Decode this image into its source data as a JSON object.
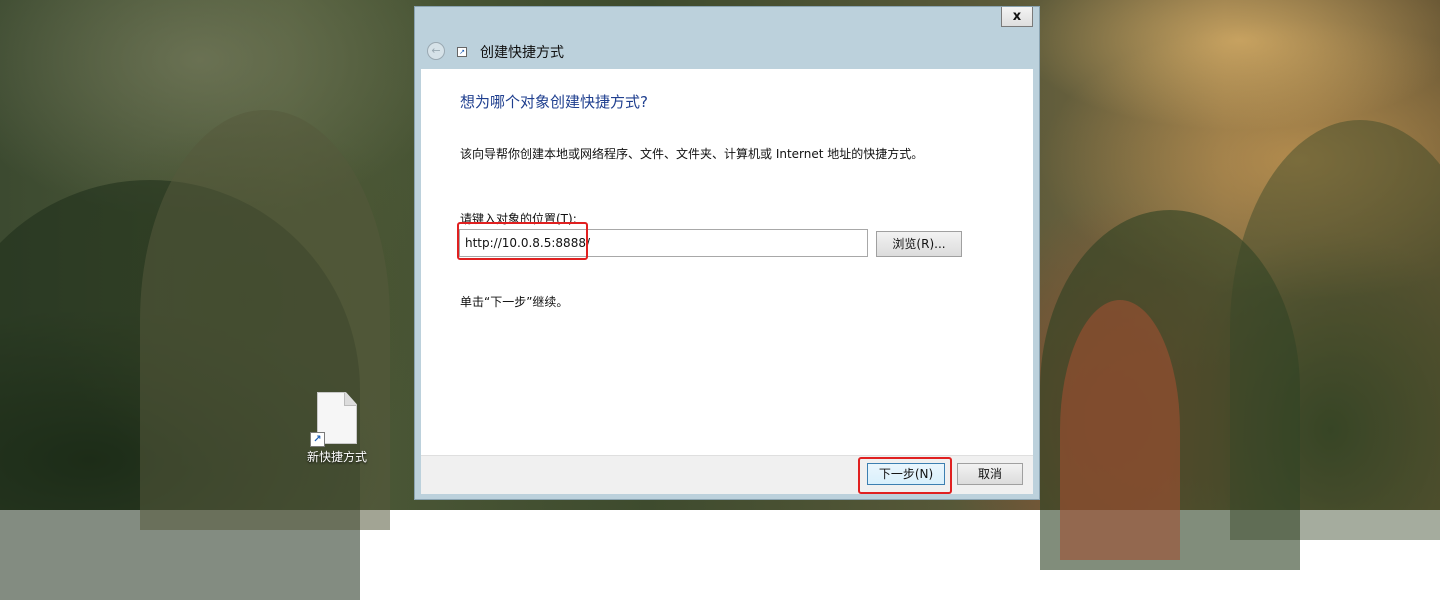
{
  "desktop": {
    "shortcut_icon": {
      "label": "新快捷方式",
      "icon": "file-shortcut-icon"
    }
  },
  "dialog": {
    "title": "创建快捷方式",
    "close_label": "x",
    "back_icon": "back-arrow-icon",
    "heading": "想为哪个对象创建快捷方式?",
    "description": "该向导帮你创建本地或网络程序、文件、文件夹、计算机或 Internet 地址的快捷方式。",
    "location_label": "请键入对象的位置(T):",
    "location_value": "http://10.0.8.5:8888/",
    "browse_label": "浏览(R)...",
    "hint": "单击“下一步”继续。",
    "next_label": "下一步(N)",
    "cancel_label": "取消",
    "highlight_color": "#e02020"
  }
}
